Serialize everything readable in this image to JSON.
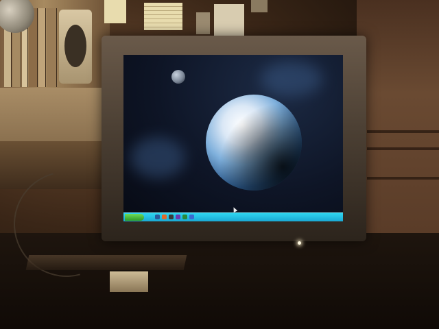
{
  "scene": {
    "subject": "crt-monitor-with-space-wallpaper",
    "colors": {
      "taskbar": "#1aa8d4",
      "planet_highlight": "#dbe8f6",
      "space": "#0e1526",
      "room": "#3a2617"
    },
    "screen": {
      "taskbar_visible": true,
      "start_button_label": "",
      "clock_text": ""
    },
    "icons": [
      "yin-yang-icon",
      "speaker-icon",
      "figurine-icon",
      "power-led-icon"
    ]
  }
}
